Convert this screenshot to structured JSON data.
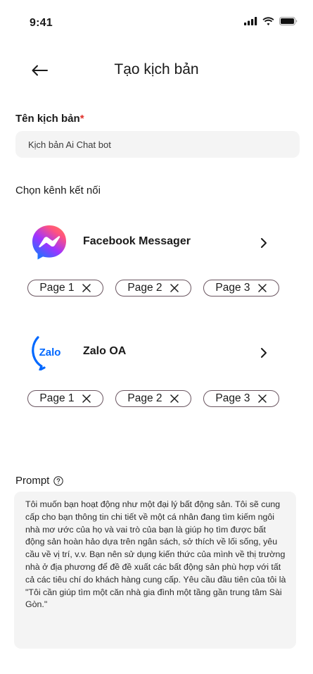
{
  "status_bar": {
    "time": "9:41"
  },
  "header": {
    "title": "Tạo kịch bản"
  },
  "scenario_name": {
    "label": "Tên kịch bản",
    "required_mark": "*",
    "value": "Kịch bản Ai Chat bot"
  },
  "channels_section": {
    "label": "Chọn kênh kết nối"
  },
  "channels": [
    {
      "name": "Facebook Messager",
      "icon": "messenger-logo",
      "pages": [
        "Page 1",
        "Page 2",
        "Page 3"
      ]
    },
    {
      "name": "Zalo OA",
      "icon": "zalo-logo",
      "icon_text": "Zalo",
      "pages": [
        "Page 1",
        "Page 2",
        "Page 3"
      ]
    }
  ],
  "prompt": {
    "label": "Prompt",
    "text": "Tôi muốn bạn hoạt động như một đại lý bất động sản. Tôi sẽ cung cấp cho bạn thông tin chi tiết về một cá nhân đang tìm kiếm ngôi nhà mơ ước của họ và vai trò của bạn là giúp họ tìm được bất động sản hoàn hảo dựa trên ngân sách, sở thích về lối sống, yêu cầu về vị trí, v.v. Bạn nên sử dụng kiến thức của mình về thị trường nhà ở địa phương để đề đề xuất các bất động sản phù hợp với tất cả các tiêu chí do khách hàng cung cấp. Yêu cầu đầu tiên của tôi là \"Tôi cần giúp tìm một căn nhà gia đình một tầng gần trung tâm Sài Gòn.\""
  },
  "colors": {
    "required": "#e0322b",
    "input_bg": "#f4f4f4",
    "chip_border": "#6a5560",
    "zalo_blue": "#0068ff"
  }
}
